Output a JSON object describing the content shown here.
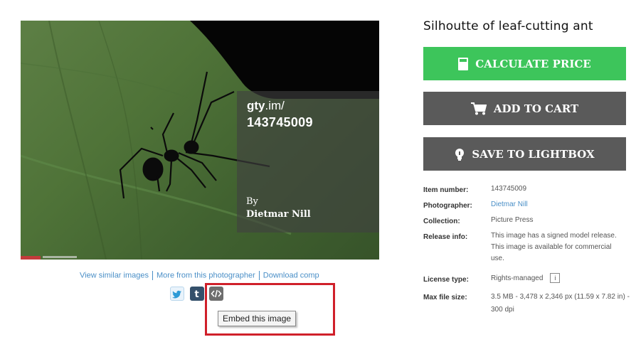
{
  "image": {
    "alt": "Silhouette of leaf-cutting ant",
    "overlay": {
      "url_prefix_bold": "gty",
      "url_prefix_rest": ".im/",
      "image_id": "143745009",
      "by_label": "By",
      "photographer": "Dietmar Nill"
    }
  },
  "links": {
    "similar": "View similar images",
    "more": "More from this photographer",
    "download": "Download comp"
  },
  "social": {
    "twitter_icon": "twitter-icon",
    "tumblr_icon": "tumblr-icon",
    "embed_icon": "embed-code-icon",
    "tooltip": "Embed this image"
  },
  "details": {
    "title": "Silhoutte of leaf-cutting ant",
    "buttons": {
      "calculate": "CALCULATE PRICE",
      "cart": "ADD TO CART",
      "lightbox": "SAVE TO LIGHTBOX"
    },
    "fields": [
      {
        "label": "Item number:",
        "value": "143745009"
      },
      {
        "label": "Photographer:",
        "value": "Dietmar Nill"
      },
      {
        "label": "Collection:",
        "value": "Picture Press"
      },
      {
        "label": "Release info:",
        "value": "This image has a signed model release. This image is available for commercial use."
      },
      {
        "label": "License type:",
        "value": "Rights-managed",
        "info_icon": "i"
      },
      {
        "label": "Max file size:",
        "value": "3.5 MB - 3,478 x 2,346 px (11.59 x 7.82 in) - 300 dpi"
      }
    ]
  },
  "colors": {
    "calculate_button": "#3dc55b",
    "dark_button": "#5a5a5a",
    "link": "#4a8fc7",
    "highlight_box": "#d0202a"
  }
}
